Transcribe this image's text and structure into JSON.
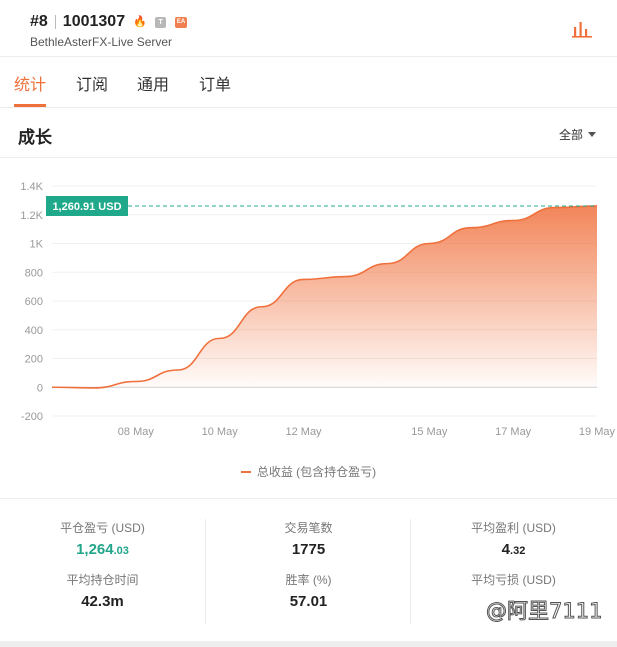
{
  "header": {
    "rank": "#8",
    "account_id": "1001307",
    "badges": {
      "fire": "🔥",
      "t": "T",
      "ea": "EA"
    },
    "server": "BethleAsterFX-Live Server",
    "icon": "bar-chart-icon"
  },
  "tabs": [
    {
      "label": "统计",
      "active": true
    },
    {
      "label": "订阅",
      "active": false
    },
    {
      "label": "通用",
      "active": false
    },
    {
      "label": "订单",
      "active": false
    }
  ],
  "section": {
    "title": "成长",
    "range": "全部"
  },
  "chart_data": {
    "type": "area",
    "x": [
      "06 May",
      "07 May",
      "08 May",
      "09 May",
      "10 May",
      "11 May",
      "12 May",
      "13 May",
      "14 May",
      "15 May",
      "16 May",
      "17 May",
      "18 May",
      "19 May"
    ],
    "x_tick_labels": [
      "08 May",
      "10 May",
      "12 May",
      "15 May",
      "17 May",
      "19 May"
    ],
    "y_tick_labels": [
      "1.4K",
      "1.2K",
      "1K",
      "800",
      "600",
      "400",
      "200",
      "0",
      "-200"
    ],
    "ylim": [
      -200,
      1400
    ],
    "series": [
      {
        "name": "总收益 (包含持仓盈亏)",
        "values": [
          0,
          -5,
          40,
          120,
          340,
          560,
          750,
          770,
          860,
          1000,
          1110,
          1160,
          1250,
          1261
        ]
      }
    ],
    "current_value_label": "1,260.91 USD",
    "current_value": 1260.91,
    "grid": "horizontal",
    "legend": "bottom-center"
  },
  "colors": {
    "accent": "#f0703c",
    "profit": "#22a58a",
    "label_bg": "#1fa98a"
  },
  "stats": {
    "closed_pl": {
      "label": "平仓盈亏 (USD)",
      "int": "1,264",
      "dec": ".03"
    },
    "trades": {
      "label": "交易笔数",
      "value": "1775"
    },
    "avg_profit": {
      "label": "平均盈利 (USD)",
      "int": "4",
      "dec": ".32"
    },
    "avg_hold": {
      "label": "平均持仓时间",
      "value": "42.3m"
    },
    "win_rate": {
      "label": "胜率 (%)",
      "value": "57.01"
    },
    "avg_loss": {
      "label": "平均亏损 (USD)",
      "value": ""
    }
  },
  "watermark": "@阿里7111"
}
